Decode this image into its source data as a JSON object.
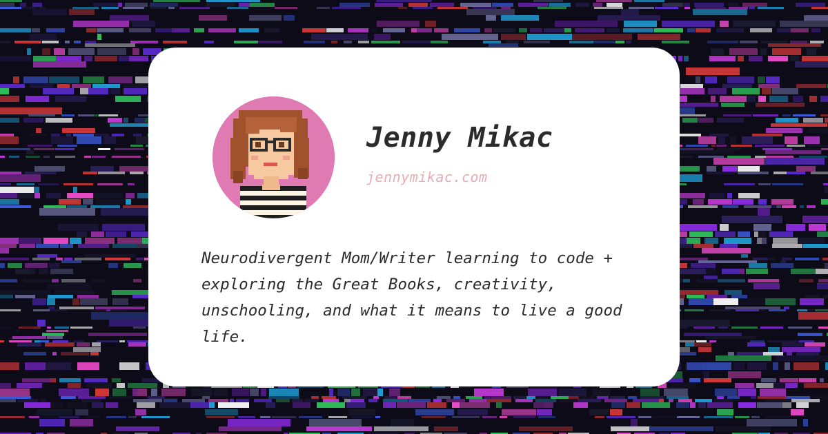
{
  "profile": {
    "name": "Jenny Mikac",
    "website": "jennymikac.com",
    "bio": "Neurodivergent Mom/Writer learning to code + exploring the Great Books, creativity, unschooling, and what it means to live a good life.",
    "avatar_icon": "pixel-art-portrait-icon"
  },
  "colors": {
    "card": "#ffffff",
    "avatar_bg": "#e07ab3",
    "name_text": "#2b2b2b",
    "website_text": "#e6adb4",
    "background": "#0d0b18"
  }
}
